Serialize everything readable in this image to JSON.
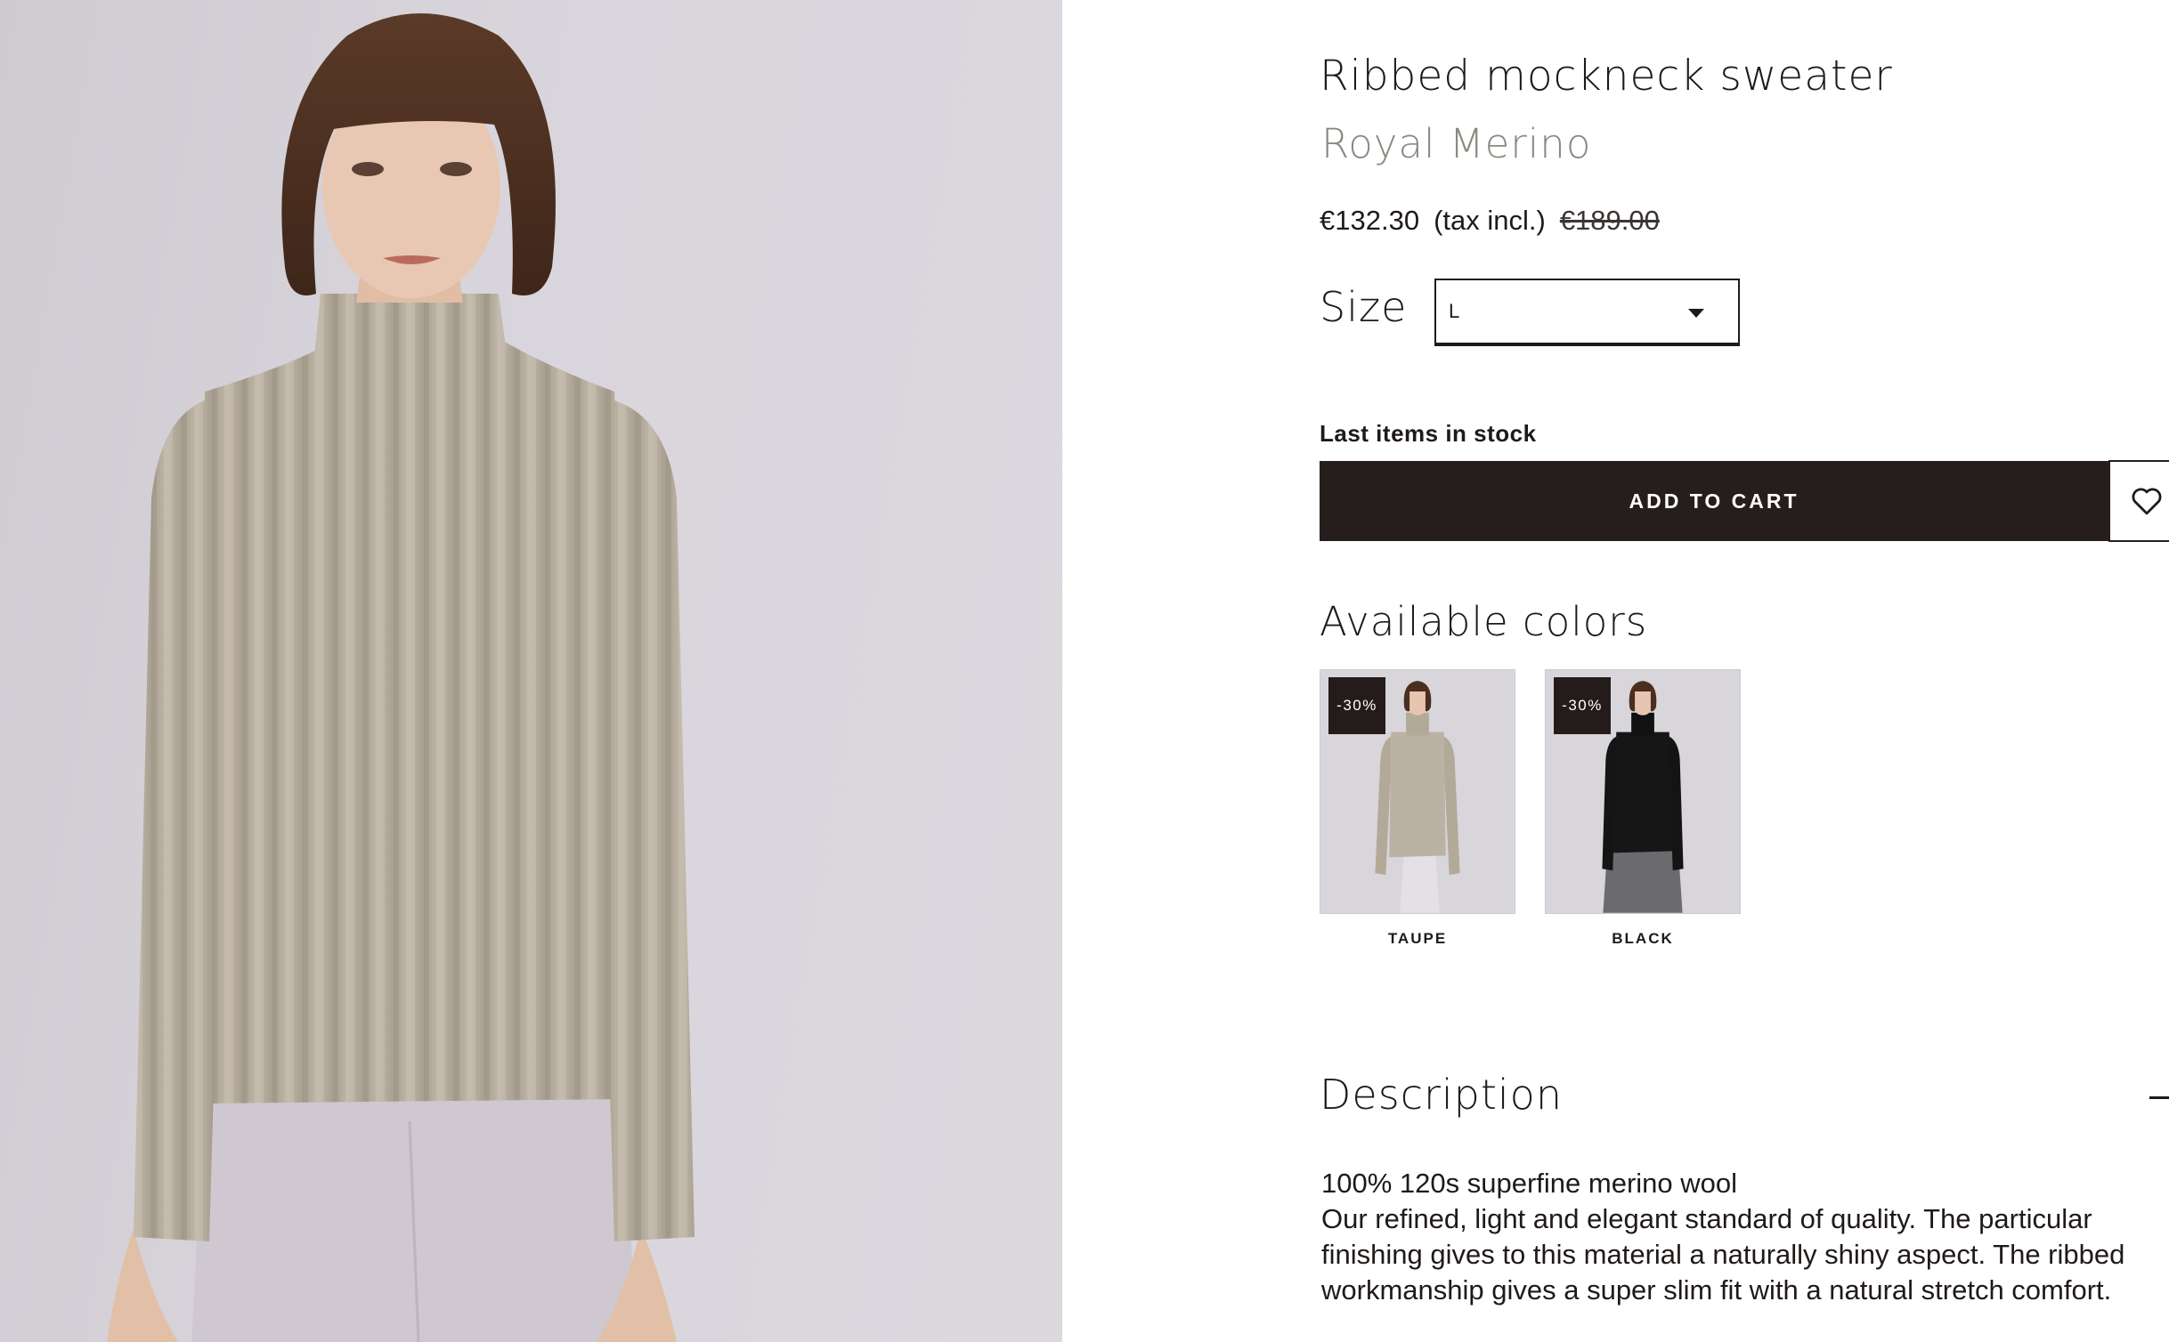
{
  "product": {
    "title": "Ribbed mockneck sweater",
    "brand": "Royal Merino",
    "price_current": "€132.30",
    "price_note": "(tax incl.)",
    "price_original": "€189.00"
  },
  "size": {
    "label": "Size",
    "selected": "L"
  },
  "stock_status": "Last items in stock",
  "buttons": {
    "add_to_cart": "ADD TO CART",
    "wishlist_icon": "heart-icon"
  },
  "colors": {
    "title": "Available colors",
    "items": [
      {
        "name": "TAUPE",
        "badge": "-30%",
        "color": "#b8ae9f"
      },
      {
        "name": "BLACK",
        "badge": "-30%",
        "color": "#111111"
      }
    ]
  },
  "description": {
    "title": "Description",
    "toggle_icon": "minus-icon",
    "lines": [
      "100% 120s superfine merino wool",
      "Our refined, light and elegant standard of quality. The particular finishing gives to this material a naturally shiny aspect. The ribbed workmanship gives a super slim fit with a natural stretch comfort."
    ]
  },
  "theme": {
    "button_color": "#251e1c",
    "brand_color": "#8a8880",
    "photo_background": "#d9d5dc"
  }
}
